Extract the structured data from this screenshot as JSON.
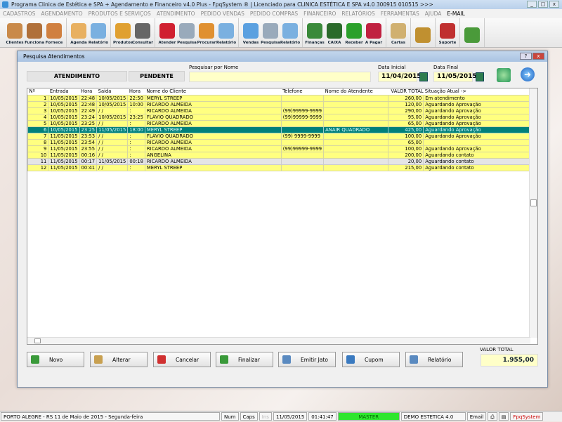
{
  "window": {
    "title": "Programa Clinica de Estética e SPA + Agendamento e Financeiro v4.0 Plus - FpqSystem ® | Licenciado para  CLINICA ESTÉTICA E SPA v4.0 300915 010515 >>>"
  },
  "menu": [
    "CADASTROS",
    "AGENDAMENTO",
    "PRODUTOS E SERVIÇOS",
    "ATENDIMENTO",
    "PEDIDO VENDAS",
    "PEDIDO COMPRAS",
    "FINANCEIRO",
    "RELATÓRIOS",
    "FERRAMENTAS",
    "AJUDA",
    "E-MAIL"
  ],
  "toolbar": [
    [
      {
        "l": "Clientes",
        "c": "#c98a4a"
      },
      {
        "l": "Funciona",
        "c": "#b0703a"
      },
      {
        "l": "Fornece",
        "c": "#d08040"
      }
    ],
    [
      {
        "l": "Agenda",
        "c": "#e8b060"
      },
      {
        "l": "Relatório",
        "c": "#7ab0e0"
      }
    ],
    [
      {
        "l": "Produtos",
        "c": "#e0a030"
      },
      {
        "l": "Consultar",
        "c": "#666"
      }
    ],
    [
      {
        "l": "Atender",
        "c": "#d02030"
      },
      {
        "l": "Pesquisa",
        "c": "#9ab"
      },
      {
        "l": "Procurar",
        "c": "#e09030"
      },
      {
        "l": "Relatório",
        "c": "#7ab0e0"
      }
    ],
    [
      {
        "l": "Vendas",
        "c": "#5aa0e0"
      },
      {
        "l": "Pesquisa",
        "c": "#9ab"
      },
      {
        "l": "Relatório",
        "c": "#7ab0e0"
      }
    ],
    [
      {
        "l": "Finanças",
        "c": "#3a8a3a"
      },
      {
        "l": "CAIXA",
        "c": "#2a6a2a"
      },
      {
        "l": "Receber",
        "c": "#2aa02a"
      },
      {
        "l": "A Pagar",
        "c": "#c02040"
      }
    ],
    [
      {
        "l": "Cartas",
        "c": "#d0b070"
      }
    ],
    [
      {
        "l": "",
        "c": "#c09030"
      }
    ],
    [
      {
        "l": "Suporte",
        "c": "#c03030"
      }
    ],
    [
      {
        "l": "",
        "c": "#4a9a3a"
      }
    ]
  ],
  "dialog": {
    "title": "Pesquisa Atendimentos",
    "tab_atendimento": "ATENDIMENTO",
    "tab_pendente": "PENDENTE",
    "search_label": "Pesquisar por Nome",
    "search_value": "",
    "data_inicial_label": "Data Inicial",
    "data_inicial": "11/04/2015",
    "data_final_label": "Data Final",
    "data_final": "11/05/2015"
  },
  "grid": {
    "columns": [
      "Nº",
      "Entrada",
      "Hora",
      "Saida",
      "Hora",
      "Nome do Cliente",
      "Telefone",
      "Nome do Atendente",
      "VALOR TOTAL",
      "Situação Atual ->"
    ],
    "rows": [
      [
        "1",
        "10/05/2015",
        "22:48",
        "10/05/2015",
        "22:50",
        "MERYL STREEP",
        "",
        "",
        "260,00",
        "Em atendimento",
        "y"
      ],
      [
        "2",
        "10/05/2015",
        "22:48",
        "10/05/2015",
        "10:00",
        "RICARDO ALMEIDA",
        "",
        "",
        "120,00",
        "Aguardando Aprovação",
        "y"
      ],
      [
        "3",
        "10/05/2015",
        "22:49",
        " / /",
        ":",
        "RICARDO ALMEIDA",
        "(99)99999-9999",
        "",
        "290,00",
        "Aguardando Aprovação",
        "y"
      ],
      [
        "4",
        "10/05/2015",
        "23:24",
        "10/05/2015",
        "23:25",
        "FLÁVIO QUADRADO",
        "(99)99999-9999",
        "",
        "95,00",
        "Aguardando Aprovação",
        "y"
      ],
      [
        "5",
        "10/05/2015",
        "23:25",
        " / /",
        ":",
        "RICARDO ALMEIDA",
        "",
        "",
        "65,00",
        "Aguardando Aprovação",
        "y"
      ],
      [
        "6",
        "10/05/2015",
        "23:25",
        "11/05/2015",
        "18:00",
        "MERYL STREEP",
        "",
        "ANAIR QUADRADO",
        "425,00",
        "Aguardando Aprovação",
        "sel"
      ],
      [
        "7",
        "11/05/2015",
        "23:53",
        " / /",
        ":",
        "FLÁVIO QUADRADO",
        "(99) 9999-9999",
        "",
        "100,00",
        "Aguardando Aprovação",
        "y"
      ],
      [
        "8",
        "11/05/2015",
        "23:54",
        " / /",
        ":",
        "RICARDO ALMEIDA",
        "",
        "",
        "65,00",
        "",
        "y"
      ],
      [
        "9",
        "11/05/2015",
        "23:55",
        " / /",
        ":",
        "RICARDO ALMEIDA",
        "(99)99999-9999",
        "",
        "100,00",
        "Aguardando Aprovação",
        "y"
      ],
      [
        "10",
        "11/05/2015",
        "00:16",
        " / /",
        ":",
        "ANGELINA",
        "",
        "",
        "200,00",
        "Aguardando contato",
        "y"
      ],
      [
        "11",
        "11/05/2015",
        "00:17",
        "11/05/2015",
        "00:18",
        "RICARDO ALMEIDA",
        "",
        "",
        "20,00",
        "Aguardando contato",
        "g"
      ],
      [
        "12",
        "11/05/2015",
        "00:41",
        " / /",
        ":",
        "MERYL STREEP",
        "",
        "",
        "215,00",
        "Aguardando contato",
        "y"
      ]
    ]
  },
  "buttons": [
    {
      "l": "Novo",
      "c": "#3a9a3a"
    },
    {
      "l": "Alterar",
      "c": "#c8a050"
    },
    {
      "l": "Cancelar",
      "c": "#d03030"
    },
    {
      "l": "Finalizar",
      "c": "#3a9a3a"
    },
    {
      "l": "Emitir Jato",
      "c": "#5a8ac0"
    },
    {
      "l": "Cupom",
      "c": "#3a7ac0"
    },
    {
      "l": "Relatório",
      "c": "#5a8ac0"
    }
  ],
  "total": {
    "label": "VALOR TOTAL",
    "value": "1.955,00"
  },
  "status": {
    "location": "PORTO ALEGRE - RS 11 de Maio de 2015 - Segunda-feira",
    "num": "Num",
    "caps": "Caps",
    "ins": "Ins",
    "date": "11/05/2015",
    "time": "01:41:47",
    "user": "MASTER",
    "company": "DEMO ESTETICA 4.0",
    "email": "Email",
    "brand": "FpqSystem"
  }
}
